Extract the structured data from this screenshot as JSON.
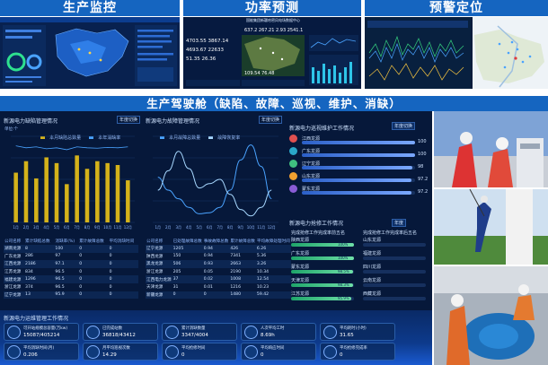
{
  "headers": {
    "monitor": "生产监控",
    "power": "功率预测",
    "warning": "预警定位",
    "cockpit": "生产驾驶舱（缺陷、故障、巡视、维护、消缺）"
  },
  "colors": {
    "header": "#1565c0",
    "panel": "#071a3e",
    "bar": "#d4b21a",
    "accent": "#4aa3ff"
  },
  "power_panel": {
    "title": "国能集团新疆哈密风电场数据中心",
    "stats": [
      "4703.55",
      "3867.14",
      "637.2",
      "267.21",
      "2.93",
      "2541.1",
      "4693.67",
      "22633",
      "51.35",
      "26.36",
      "109.54",
      "76.48"
    ]
  },
  "defect_panel": {
    "title": "新源电力缺陷管理情况",
    "button": "年度切换",
    "unit": "单位:个",
    "legend": [
      "本月缺陷总数量",
      "本年消缺率"
    ]
  },
  "fault_panel": {
    "title": "新源电力故障管理情况",
    "button": "年度切换",
    "legend": [
      "本月故障总数量",
      "故障恢复率"
    ]
  },
  "inspection_panel": {
    "title": "新源电力巡视维护工作情况",
    "button": "年度切换",
    "items": [
      {
        "label": "江西龙源",
        "value": "100",
        "fill": 1.0,
        "color": "#e05050"
      },
      {
        "label": "广东龙源",
        "value": "100",
        "fill": 1.0,
        "color": "#2aa7c9"
      },
      {
        "label": "辽宁龙源",
        "value": "98",
        "fill": 0.98,
        "color": "#3fbf7f"
      },
      {
        "label": "山东龙源",
        "value": "97.2",
        "fill": 0.972,
        "color": "#f0a030"
      },
      {
        "label": "蒙东龙源",
        "value": "97.2",
        "fill": 0.972,
        "color": "#8a5cd6"
      }
    ]
  },
  "repair_panel": {
    "title": "新源电力抢修工作情况",
    "button": "年度",
    "left_header": "完成抢修工作完成率前五名",
    "right_header": "完成抢修工作完成率后五名",
    "left": [
      {
        "label": "陕西龙源",
        "value": "100%",
        "fill": 1.0
      },
      {
        "label": "广东龙源",
        "value": "100%",
        "fill": 1.0
      },
      {
        "label": "蒙东龙源",
        "value": "98.5%",
        "fill": 0.985
      },
      {
        "label": "天津龙源",
        "value": "98.3%",
        "fill": 0.983
      },
      {
        "label": "江苏龙源",
        "value": "95.9%",
        "fill": 0.959
      }
    ],
    "right": [
      {
        "label": "山东龙源",
        "value": "",
        "fill": 0
      },
      {
        "label": "福建龙源",
        "value": "",
        "fill": 0
      },
      {
        "label": "四川龙源",
        "value": "",
        "fill": 0
      },
      {
        "label": "云南龙源",
        "value": "",
        "fill": 0
      },
      {
        "label": "西藏龙源",
        "value": "",
        "fill": 0
      }
    ]
  },
  "defect_table": {
    "headers": [
      "公司名称",
      "累计缺陷总数",
      "消缺率(%)",
      "累计故障总数",
      "平均消缺时间"
    ],
    "rows": [
      [
        "湖南龙源",
        "8",
        "100",
        "0",
        "0"
      ],
      [
        "广东龙源",
        "286",
        "97",
        "0",
        "0"
      ],
      [
        "江西龙源",
        "2186",
        "97.1",
        "0",
        "0"
      ],
      [
        "江苏龙源",
        "834",
        "96.5",
        "0",
        "0"
      ],
      [
        "福建龙源",
        "1296",
        "96.5",
        "0",
        "0"
      ],
      [
        "浙江龙源",
        "374",
        "96.5",
        "0",
        "0"
      ],
      [
        "辽宁龙源",
        "13",
        "95.9",
        "0",
        "0"
      ]
    ]
  },
  "fault_table": {
    "headers": [
      "公司名称",
      "已处理故障总数",
      "事故故障总数",
      "累计故障总数",
      "平均故障处理时间"
    ],
    "rows": [
      [
        "辽宁龙源",
        "1205",
        "0.94",
        "426",
        "6.26"
      ],
      [
        "陕西龙源",
        "150",
        "0.94",
        "7341",
        "5.36"
      ],
      [
        "黑龙龙源",
        "506",
        "0.93",
        "2663",
        "3.26"
      ],
      [
        "浙江龙源",
        "205",
        "0.05",
        "2190",
        "10.34"
      ],
      [
        "江西电力龙源",
        "37",
        "0.02",
        "1008",
        "12.54"
      ],
      [
        "天津龙源",
        "31",
        "0.01",
        "1216",
        "10.23"
      ],
      [
        "新疆龙源",
        "0",
        "0",
        "1480",
        "59.42"
      ]
    ]
  },
  "kpi_panel": {
    "title": "新源电力运维管理工作情况",
    "items": [
      {
        "label": "可开站规模总容量(万kw)",
        "value": "15087/405214"
      },
      {
        "label": "已完成站数",
        "value": "36818/43412"
      },
      {
        "label": "累计消缺数量",
        "value": "3347/4004"
      },
      {
        "label": "人次平均工时",
        "value": "8.69h"
      },
      {
        "label": "平均耗时(小时)",
        "value": "31.65"
      },
      {
        "label": "平均消缺时间(月)",
        "value": "0.206"
      },
      {
        "label": "月平均巡视次数",
        "value": "14.29"
      },
      {
        "label": "平均抢修时间",
        "value": "0"
      },
      {
        "label": "平均响应时间",
        "value": "0"
      },
      {
        "label": "平均抢修完成率",
        "value": "0"
      }
    ]
  },
  "chart_data": [
    {
      "type": "bar",
      "title": "新源电力缺陷管理情况",
      "categories": [
        "1月",
        "2月",
        "3月",
        "4月",
        "5月",
        "6月",
        "7月",
        "8月",
        "9月",
        "10月",
        "11月",
        "12月"
      ],
      "series": [
        {
          "name": "本月缺陷总数量",
          "values": [
            260,
            320,
            230,
            340,
            310,
            200,
            350,
            280,
            320,
            310,
            300,
            220
          ]
        },
        {
          "name": "本年消缺率",
          "values": [
            400,
            390,
            395,
            385,
            390,
            380,
            395,
            390,
            388,
            392,
            390,
            395
          ]
        }
      ],
      "ylim": [
        0,
        450
      ]
    },
    {
      "type": "line",
      "title": "新源电力故障管理情况",
      "categories": [
        "1月",
        "2月",
        "3月",
        "4月",
        "5月",
        "6月",
        "7月",
        "8月",
        "9月",
        "10月",
        "11月",
        "12月"
      ],
      "series": [
        {
          "name": "本月故障总数量",
          "values": [
            210,
            150,
            110,
            70,
            40,
            45,
            70,
            150,
            290,
            360,
            260,
            110
          ]
        },
        {
          "name": "故障恢复率",
          "values": [
            150,
            240,
            330,
            250,
            160,
            180,
            200,
            130,
            60,
            30,
            70,
            150
          ]
        }
      ],
      "ylim": [
        0,
        400
      ]
    }
  ]
}
